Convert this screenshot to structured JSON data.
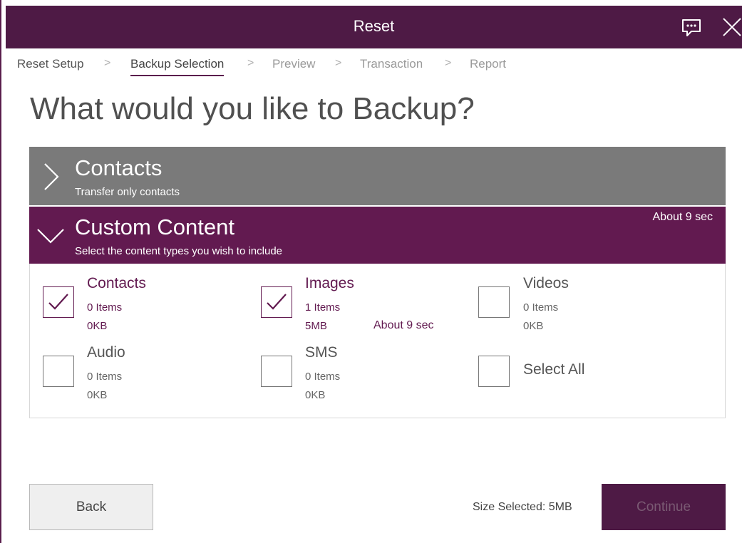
{
  "window": {
    "title": "Reset"
  },
  "breadcrumb": {
    "items": [
      "Reset Setup",
      "Backup Selection",
      "Preview",
      "Transaction",
      "Report"
    ],
    "separator": ">"
  },
  "heading": "What would you like to Backup?",
  "accordion": {
    "contacts": {
      "title": "Contacts",
      "subtitle": "Transfer only contacts"
    },
    "custom": {
      "title": "Custom Content",
      "subtitle": "Select the content types you wish to include",
      "time": "About 9 sec"
    }
  },
  "items": [
    {
      "name": "Contacts",
      "count": "0 Items",
      "size": "0KB",
      "checked": true
    },
    {
      "name": "Images",
      "count": "1 Items",
      "size": "5MB",
      "time": "About 9 sec",
      "checked": true
    },
    {
      "name": "Videos",
      "count": "0 Items",
      "size": "0KB",
      "checked": false
    },
    {
      "name": "Audio",
      "count": "0 Items",
      "size": "0KB",
      "checked": false
    },
    {
      "name": "SMS",
      "count": "0 Items",
      "size": "0KB",
      "checked": false
    },
    {
      "name": "Select All",
      "checked": false
    }
  ],
  "footer": {
    "back_label": "Back",
    "size_selected": "Size Selected: 5MB",
    "continue_label": "Continue",
    "continue_enabled": false
  },
  "colors": {
    "titlebar": "#4e1a45",
    "accent": "#621a50",
    "contacts_header": "#7a7a7a"
  },
  "icons": {
    "feedback": "feedback-icon",
    "close": "close-icon",
    "chevron_right": "chevron-right-icon",
    "chevron_down": "chevron-down-icon",
    "checkmark": "checkmark-icon"
  }
}
